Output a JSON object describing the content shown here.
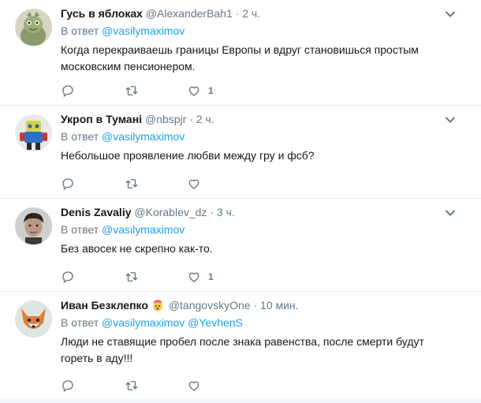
{
  "tweets": [
    {
      "name": "Гусь в яблоках",
      "handle": "@AlexanderBah1",
      "time": "2 ч.",
      "reply_prefix": "В ответ",
      "mentions": [
        "@vasilymaximov"
      ],
      "text": "Когда перекраиваешь границы Европы и вдруг становишься простым московским пенсионером.",
      "like_count": "1"
    },
    {
      "name": "Укроп в Тумані",
      "handle": "@nbspjr",
      "time": "2 ч.",
      "reply_prefix": "В ответ",
      "mentions": [
        "@vasilymaximov"
      ],
      "text": "Небольшое проявление любви между гру и фсб?",
      "like_count": ""
    },
    {
      "name": "Denis Zavaliy",
      "handle": "@Korablev_dz",
      "time": "3 ч.",
      "reply_prefix": "В ответ",
      "mentions": [
        "@vasilymaximov"
      ],
      "text": "Без авосек не скрепно как-то.",
      "like_count": "1"
    },
    {
      "name": "Иван Безклепко",
      "handle": "@tangovskyOne",
      "time": "10 мин.",
      "reply_prefix": "В ответ",
      "mentions": [
        "@vasilymaximov",
        "@YevhenS"
      ],
      "text": "Люди не ставящие пробел после знака равенства, после смерти будут гореть в аду!!!",
      "like_count": "",
      "name_badge_emoji": "🤯"
    }
  ],
  "separator": "·",
  "colors": {
    "link": "#1da1f2",
    "muted": "#657786",
    "text": "#14171a",
    "border": "#e6ecf0"
  },
  "icons": [
    "reply-icon",
    "retweet-icon",
    "like-icon",
    "chevron-down-icon"
  ]
}
